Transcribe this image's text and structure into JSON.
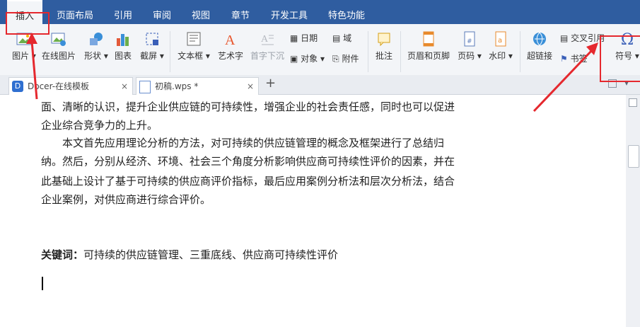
{
  "menubar": {
    "tabs": [
      {
        "label": "插入"
      },
      {
        "label": "页面布局"
      },
      {
        "label": "引用"
      },
      {
        "label": "审阅"
      },
      {
        "label": "视图"
      },
      {
        "label": "章节"
      },
      {
        "label": "开发工具"
      },
      {
        "label": "特色功能"
      }
    ]
  },
  "ribbon": {
    "picture": "图片",
    "online_picture": "在线图片",
    "shapes": "形状",
    "chart": "图表",
    "screenshot": "截屏",
    "textbox": "文本框",
    "wordart": "艺术字",
    "dropcap": "首字下沉",
    "date": "日期",
    "field": "域",
    "object": "对象",
    "attachment": "附件",
    "comment": "批注",
    "header_footer": "页眉和页脚",
    "page_number": "页码",
    "watermark": "水印",
    "hyperlink": "超链接",
    "cross_ref": "交叉引用",
    "bookmark": "书签",
    "symbol": "符号",
    "symbol_glyph": "Ω"
  },
  "tabs": {
    "docer": "Docer-在线模板",
    "doc": "初稿.wps *",
    "close": "×",
    "add": "+"
  },
  "document": {
    "lines": [
      "面、清晰的认识，提升企业供应链的可持续性，增强企业的社会责任感，同时也可以促进",
      "企业综合竞争力的上升。",
      "本文首先应用理论分析的方法，对可持续的供应链管理的概念及框架进行了总结归",
      "纳。然后，分别从经济、环境、社会三个角度分析影响供应商可持续性评价的因素，并在",
      "此基础上设计了基于可持续的供应商评价指标，最后应用案例分析法和层次分析法，结合",
      "企业案例，对供应商进行综合评价。"
    ],
    "keywords_label": "关键词：",
    "keywords": "可持续的供应链管理、三重底线、供应商可持续性评价"
  },
  "colors": {
    "menubar": "#2f5da0",
    "ribbon": "#f3f5f8",
    "highlight": "#e5282e"
  }
}
